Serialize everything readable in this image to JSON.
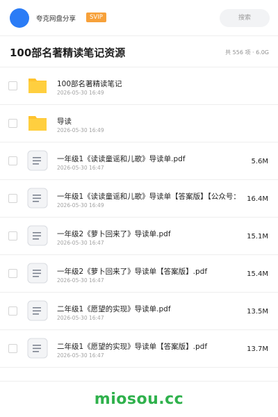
{
  "header": {
    "share_name": "夸克网盘分享",
    "badge": "SVIP",
    "search_placeholder": "搜索",
    "avatar_color": "#2b7cf6",
    "badge_color": "#f7a13a"
  },
  "folder": {
    "title": "100部名著精读笔记资源",
    "summary": "共 556 项 · 6.0G"
  },
  "items": [
    {
      "type": "folder",
      "icon": "folder-icon",
      "name": "100部名著精读笔记",
      "date": "2026-05-30 16:49",
      "size": ""
    },
    {
      "type": "folder",
      "icon": "folder-icon",
      "name": "导读",
      "date": "2026-05-30 16:49",
      "size": ""
    },
    {
      "type": "file",
      "icon": "document-icon",
      "name": "一年级1《读读童谣和儿歌》导读单.pdf",
      "date": "2026-05-30 16:47",
      "size": "5.6M"
    },
    {
      "type": "file",
      "icon": "document-icon",
      "name": "一年级1《读读童谣和儿歌》导读单【答案版】【公众号：",
      "date": "2026-05-30 16:49",
      "size": "16.4M"
    },
    {
      "type": "file",
      "icon": "document-icon",
      "name": "一年级2《萝卜回来了》导读单.pdf",
      "date": "2026-05-30 16:47",
      "size": "15.1M"
    },
    {
      "type": "file",
      "icon": "document-icon",
      "name": "一年级2《萝卜回来了》导读单【答案版】.pdf",
      "date": "2026-05-30 16:47",
      "size": "15.4M"
    },
    {
      "type": "file",
      "icon": "document-icon",
      "name": "二年级1《愿望的实现》导读单.pdf",
      "date": "2026-05-30 16:47",
      "size": "13.5M"
    },
    {
      "type": "file",
      "icon": "document-icon",
      "name": "二年级1《愿望的实现》导读单【答案版】.pdf",
      "date": "2026-05-30 16:47",
      "size": "13.7M"
    }
  ],
  "watermark": {
    "text": "miosou.cc",
    "color": "#2fb14c"
  }
}
